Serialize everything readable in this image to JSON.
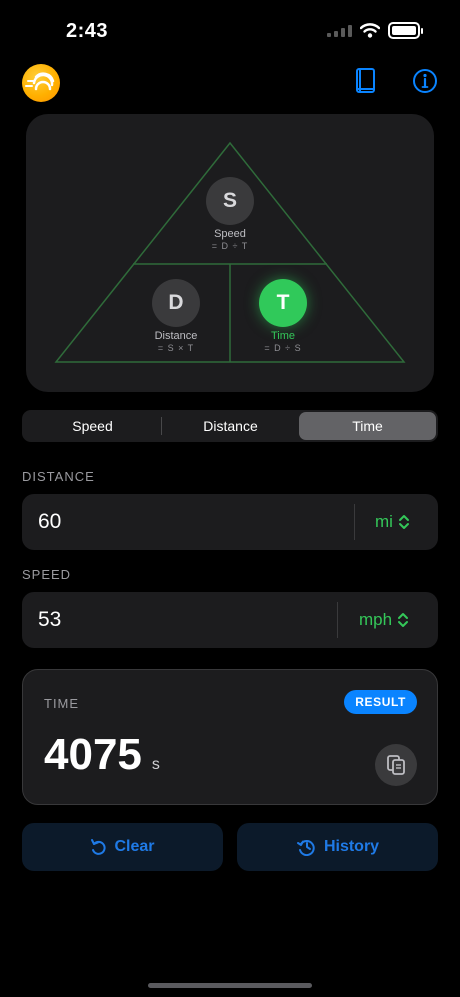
{
  "status_bar": {
    "time": "2:43"
  },
  "triangle": {
    "speed": {
      "letter": "S",
      "name": "Speed",
      "formula": "= D ÷ T"
    },
    "distance": {
      "letter": "D",
      "name": "Distance",
      "formula": "= S × T"
    },
    "time": {
      "letter": "T",
      "name": "Time",
      "formula": "= D ÷ S",
      "active": true
    }
  },
  "mode_tabs": [
    {
      "label": "Speed",
      "selected": false
    },
    {
      "label": "Distance",
      "selected": false
    },
    {
      "label": "Time",
      "selected": true
    }
  ],
  "distance": {
    "label": "DISTANCE",
    "value": "60",
    "unit": "mi"
  },
  "speed": {
    "label": "SPEED",
    "value": "53",
    "unit": "mph"
  },
  "result": {
    "label": "TIME",
    "badge": "RESULT",
    "value": "4075",
    "unit": "s"
  },
  "actions": {
    "clear_label": "Clear",
    "history_label": "History"
  },
  "icons": {
    "logo": "speed-logo-icon",
    "guide": "book-icon",
    "info": "info-icon",
    "copy": "copy-icon",
    "clear": "counterclockwise-arrow-icon",
    "history": "clock-arrow-icon",
    "unit_picker": "chevron-up-down-icon"
  },
  "colors": {
    "background": "#000000",
    "card": "#1c1c1e",
    "accent_blue": "#0a84ff",
    "accent_green": "#34c759",
    "triangle_stroke": "#2f6b3a"
  }
}
